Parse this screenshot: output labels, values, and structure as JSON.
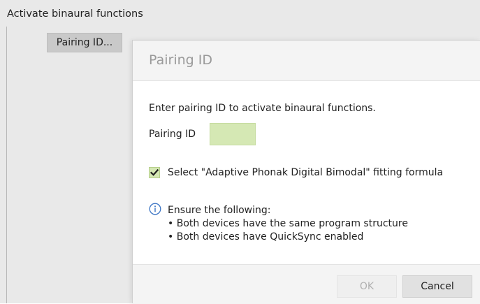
{
  "panel": {
    "title": "Activate binaural functions",
    "pairing_button_label": "Pairing ID..."
  },
  "dialog": {
    "title": "Pairing ID",
    "instruction": "Enter pairing ID to activate binaural functions.",
    "pairing_id": {
      "label": "Pairing ID",
      "value": "",
      "placeholder": ""
    },
    "checkbox": {
      "label": "Select \"Adaptive Phonak Digital Bimodal\" fitting formula",
      "checked": true
    },
    "info": {
      "icon": "info-icon",
      "heading": "Ensure the following:",
      "items": [
        "• Both devices have the same program structure",
        "• Both devices have QuickSync enabled"
      ]
    },
    "buttons": {
      "ok_label": "OK",
      "cancel_label": "Cancel"
    }
  },
  "colors": {
    "accent_green": "#d5e8b4",
    "check_mark": "#1e1e1e",
    "info_blue": "#3b74c4",
    "disabled_text": "#b0b0b0",
    "panel_bg": "#e9e9e9"
  }
}
